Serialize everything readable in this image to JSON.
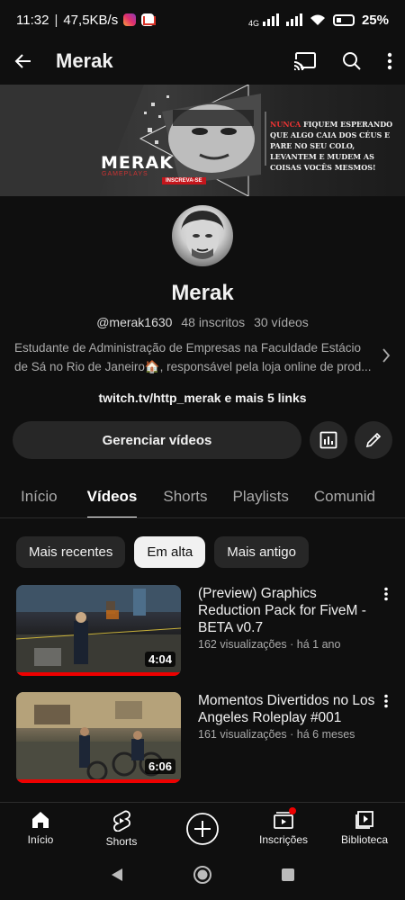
{
  "status_bar": {
    "time": "11:32",
    "speed": "47,5KB/s",
    "network": "4G",
    "battery": "25%"
  },
  "app_bar": {
    "title": "Merak",
    "icons": [
      "back-arrow-icon",
      "cast-icon",
      "search-icon",
      "more-vert-icon"
    ]
  },
  "banner": {
    "brand": "MERAK",
    "brand_sub": "GAMEPLAYS",
    "cta": "INSCREVA-SE",
    "quote_red": "NUNCA",
    "quote_rest": "FIQUEM ESPERANDO QUE ALGO CAIA DOS CÉUS E PARE NO SEU COLO, LEVANTEM E MUDEM AS COISAS VOCÊS MESMOS!"
  },
  "channel": {
    "name": "Merak",
    "handle": "@merak1630",
    "subscribers": "48 inscritos",
    "videos": "30 vídeos",
    "description": "Estudante de Administração de Empresas na Faculdade Estácio de Sá no Rio de Janeiro🏠, responsável pela loja online de prod...",
    "links": "twitch.tv/http_merak e mais 5 links"
  },
  "actions": {
    "manage_videos": "Gerenciar vídeos"
  },
  "tabs": [
    {
      "label": "Início",
      "active": false
    },
    {
      "label": "Vídeos",
      "active": true
    },
    {
      "label": "Shorts",
      "active": false
    },
    {
      "label": "Playlists",
      "active": false
    },
    {
      "label": "Comunid",
      "active": false
    }
  ],
  "chips": [
    {
      "label": "Mais recentes",
      "active": false
    },
    {
      "label": "Em alta",
      "active": true
    },
    {
      "label": "Mais antigo",
      "active": false
    }
  ],
  "videos": [
    {
      "title": "(Preview) Graphics Reduction Pack for FiveM - BETA v0.7",
      "meta": "162 visualizações · há 1 ano",
      "duration": "4:04",
      "progress": 1.0
    },
    {
      "title": "Momentos Divertidos no Los Angeles Roleplay #001",
      "meta": "161 visualizações · há 6 meses",
      "duration": "6:06",
      "progress": 1.0
    }
  ],
  "bottom_nav": [
    {
      "label": "Início"
    },
    {
      "label": "Shorts"
    },
    {
      "label": ""
    },
    {
      "label": "Inscrições"
    },
    {
      "label": "Biblioteca"
    }
  ],
  "colors": {
    "background": "#0f0f0f",
    "surface": "#272727",
    "accent_red": "#e00000",
    "text_primary": "#f1f1f1",
    "text_secondary": "#aaaaaa"
  }
}
